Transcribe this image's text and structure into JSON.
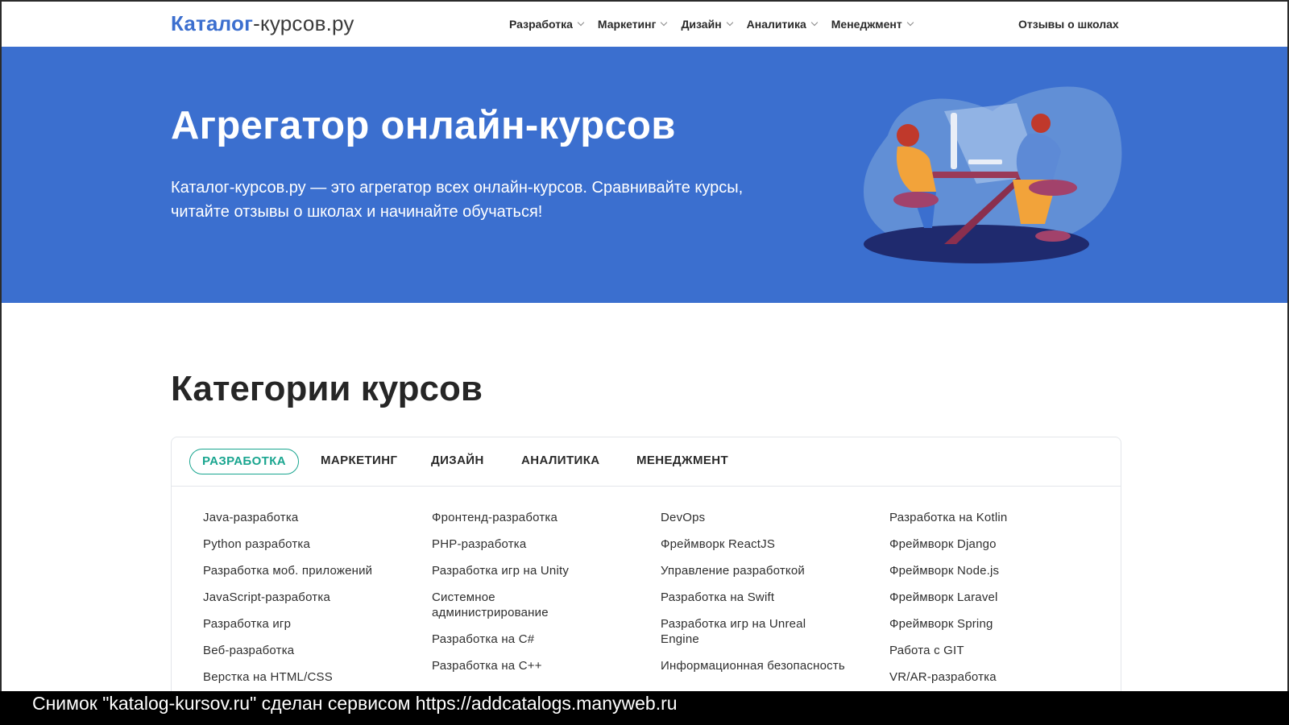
{
  "header": {
    "logo_bold": "Каталог",
    "logo_rest": "-курсов.ру",
    "nav": [
      {
        "label": "Разработка"
      },
      {
        "label": "Маркетинг"
      },
      {
        "label": "Дизайн"
      },
      {
        "label": "Аналитика"
      },
      {
        "label": "Менеджмент"
      }
    ],
    "reviews_link": "Отзывы о школах"
  },
  "hero": {
    "title": "Агрегатор онлайн-курсов",
    "subtitle_line1": "Каталог-курсов.ру — это агрегатор всех онлайн-курсов. Сравнивайте курсы,",
    "subtitle_line2": "читайте отзывы о школах и начинайте обучаться!"
  },
  "categories": {
    "title": "Категории курсов",
    "tabs": [
      {
        "label": "РАЗРАБОТКА",
        "active": true
      },
      {
        "label": "МАРКЕТИНГ"
      },
      {
        "label": "ДИЗАЙН"
      },
      {
        "label": "АНАЛИТИКА"
      },
      {
        "label": "МЕНЕДЖМЕНТ"
      }
    ],
    "columns": [
      [
        "Java-разработка",
        "Python разработка",
        "Разработка моб. приложений",
        "JavaScript-разработка",
        "Разработка игр",
        "Веб-разработка",
        "Верстка на HTML/CSS"
      ],
      [
        "Фронтенд-разработка",
        "PHP-разработка",
        "Разработка игр на Unity",
        "Системное администрирование",
        "Разработка на C#",
        "Разработка на C++"
      ],
      [
        "DevOps",
        "Фреймворк ReactJS",
        "Управление разработкой",
        "Разработка на Swift",
        "Разработка игр на Unreal Engine",
        "Информационная безопасность"
      ],
      [
        "Разработка на Kotlin",
        "Фреймворк Django",
        "Фреймворк Node.js",
        "Фреймворк Laravel",
        "Фреймворк Spring",
        "Работа с GIT",
        "VR/AR-разработка"
      ]
    ]
  },
  "caption": "Снимок \"katalog-kursov.ru\" сделан сервисом https://addcatalogs.manyweb.ru",
  "colors": {
    "brand_blue": "#3b6fcf",
    "accent_teal": "#19a58f"
  }
}
